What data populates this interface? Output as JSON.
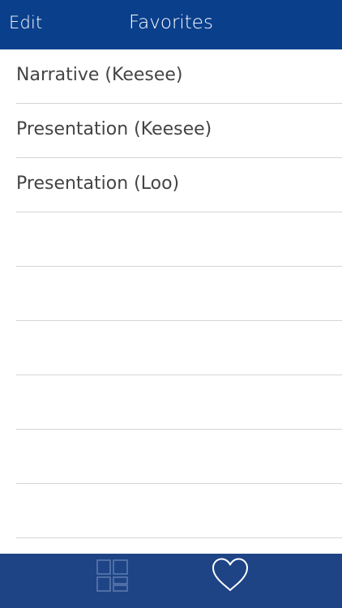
{
  "navbar": {
    "edit_label": "Edit",
    "title": "Favorites",
    "background": "#0a3f8c"
  },
  "favorites": {
    "items": [
      {
        "label": "Narrative (Keesee)"
      },
      {
        "label": "Presentation (Keesee)"
      },
      {
        "label": "Presentation (Loo)"
      },
      {
        "label": ""
      },
      {
        "label": ""
      },
      {
        "label": ""
      },
      {
        "label": ""
      },
      {
        "label": ""
      },
      {
        "label": ""
      }
    ]
  },
  "tabbar": {
    "background": "#1e4486",
    "tabs": [
      {
        "icon": "grid-icon",
        "active": false
      },
      {
        "icon": "heart-icon",
        "active": true
      }
    ]
  }
}
